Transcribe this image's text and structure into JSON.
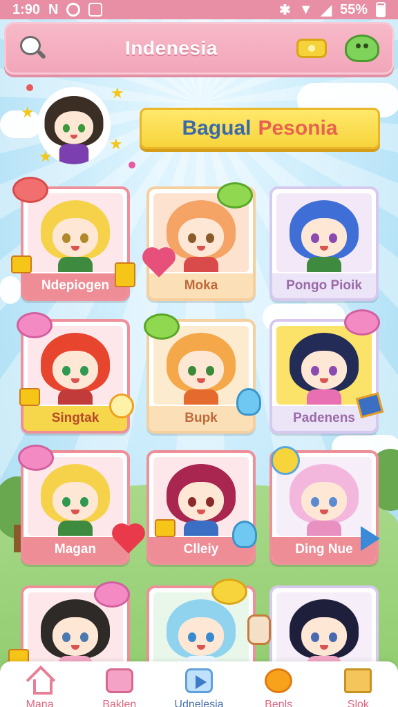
{
  "status_bar": {
    "time": "1:90",
    "app_glyph": "N",
    "battery": "55%"
  },
  "app_bar": {
    "title": "Indenesia",
    "icons": [
      "search-icon",
      "bow-icon",
      "slime-icon"
    ]
  },
  "banner": {
    "word1": "Bagual",
    "word2": "Pesonia"
  },
  "characters": [
    {
      "name": "Ndepiogen",
      "hair": "#f6d24a",
      "shirt": "#3e8a3e",
      "eye": "#b08a2a",
      "bg": "#fde7ea",
      "label_style": "pink"
    },
    {
      "name": "Moka",
      "hair": "#f5a466",
      "shirt": "#d94b4b",
      "eye": "#8a5a2a",
      "bg": "#fde2d0",
      "label_style": "peach"
    },
    {
      "name": "Pongo Pioik",
      "hair": "#3f6fd6",
      "shirt": "#3e8a3e",
      "eye": "#8a4ab0",
      "bg": "#f3e8f7",
      "label_style": "lav"
    },
    {
      "name": "Singtak",
      "hair": "#e8452f",
      "shirt": "#c23b3b",
      "eye": "#2f9a4f",
      "bg": "#fde7ea",
      "label_style": "yellow"
    },
    {
      "name": "Bupk",
      "hair": "#f4a84a",
      "shirt": "#e46a2e",
      "eye": "#3a8a3a",
      "bg": "#fdebd0",
      "label_style": "peach"
    },
    {
      "name": "Padenens",
      "hair": "#232c56",
      "shirt": "#e76fb2",
      "eye": "#8a4ab0",
      "bg": "#fbe36a",
      "label_style": "lav"
    },
    {
      "name": "Magan",
      "hair": "#f6d24a",
      "shirt": "#3e8a3e",
      "eye": "#2f9a4f",
      "bg": "#fde7ea",
      "label_style": "pink"
    },
    {
      "name": "Clleiy",
      "hair": "#a8264f",
      "shirt": "#3a6fc4",
      "eye": "#8a2a2a",
      "bg": "#fde7ea",
      "label_style": "pink"
    },
    {
      "name": "Ding Nue",
      "hair": "#f3b6dd",
      "shirt": "#e891c0",
      "eye": "#5a8ad0",
      "bg": "#f6eef8",
      "label_style": "pink"
    },
    {
      "name": "",
      "hair": "#2d2a28",
      "shirt": "#f3a7c6",
      "eye": "#4a7ab0",
      "bg": "#fde7ea",
      "label_style": "pink"
    },
    {
      "name": "",
      "hair": "#8fd3ef",
      "shirt": "#e9f6ff",
      "eye": "#3a8ad0",
      "bg": "#e8f7ea",
      "label_style": "pink"
    },
    {
      "name": "",
      "hair": "#1e1f3a",
      "shirt": "#f3a7c6",
      "eye": "#4a6ab0",
      "bg": "#f6eef8",
      "label_style": "lav"
    }
  ],
  "bottom_nav": [
    {
      "label": "Mana",
      "icon": "home-icon"
    },
    {
      "label": "Baklen",
      "icon": "bag-icon"
    },
    {
      "label": "Udnelesia",
      "icon": "play-icon"
    },
    {
      "label": "Benls",
      "icon": "flower-icon"
    },
    {
      "label": "Slok",
      "icon": "box-icon"
    }
  ],
  "colors": {
    "accent_pink": "#f2a6ba",
    "banner_yellow": "#f7d43c",
    "sky": "#b9e4f7",
    "grass": "#8ecb6c"
  }
}
